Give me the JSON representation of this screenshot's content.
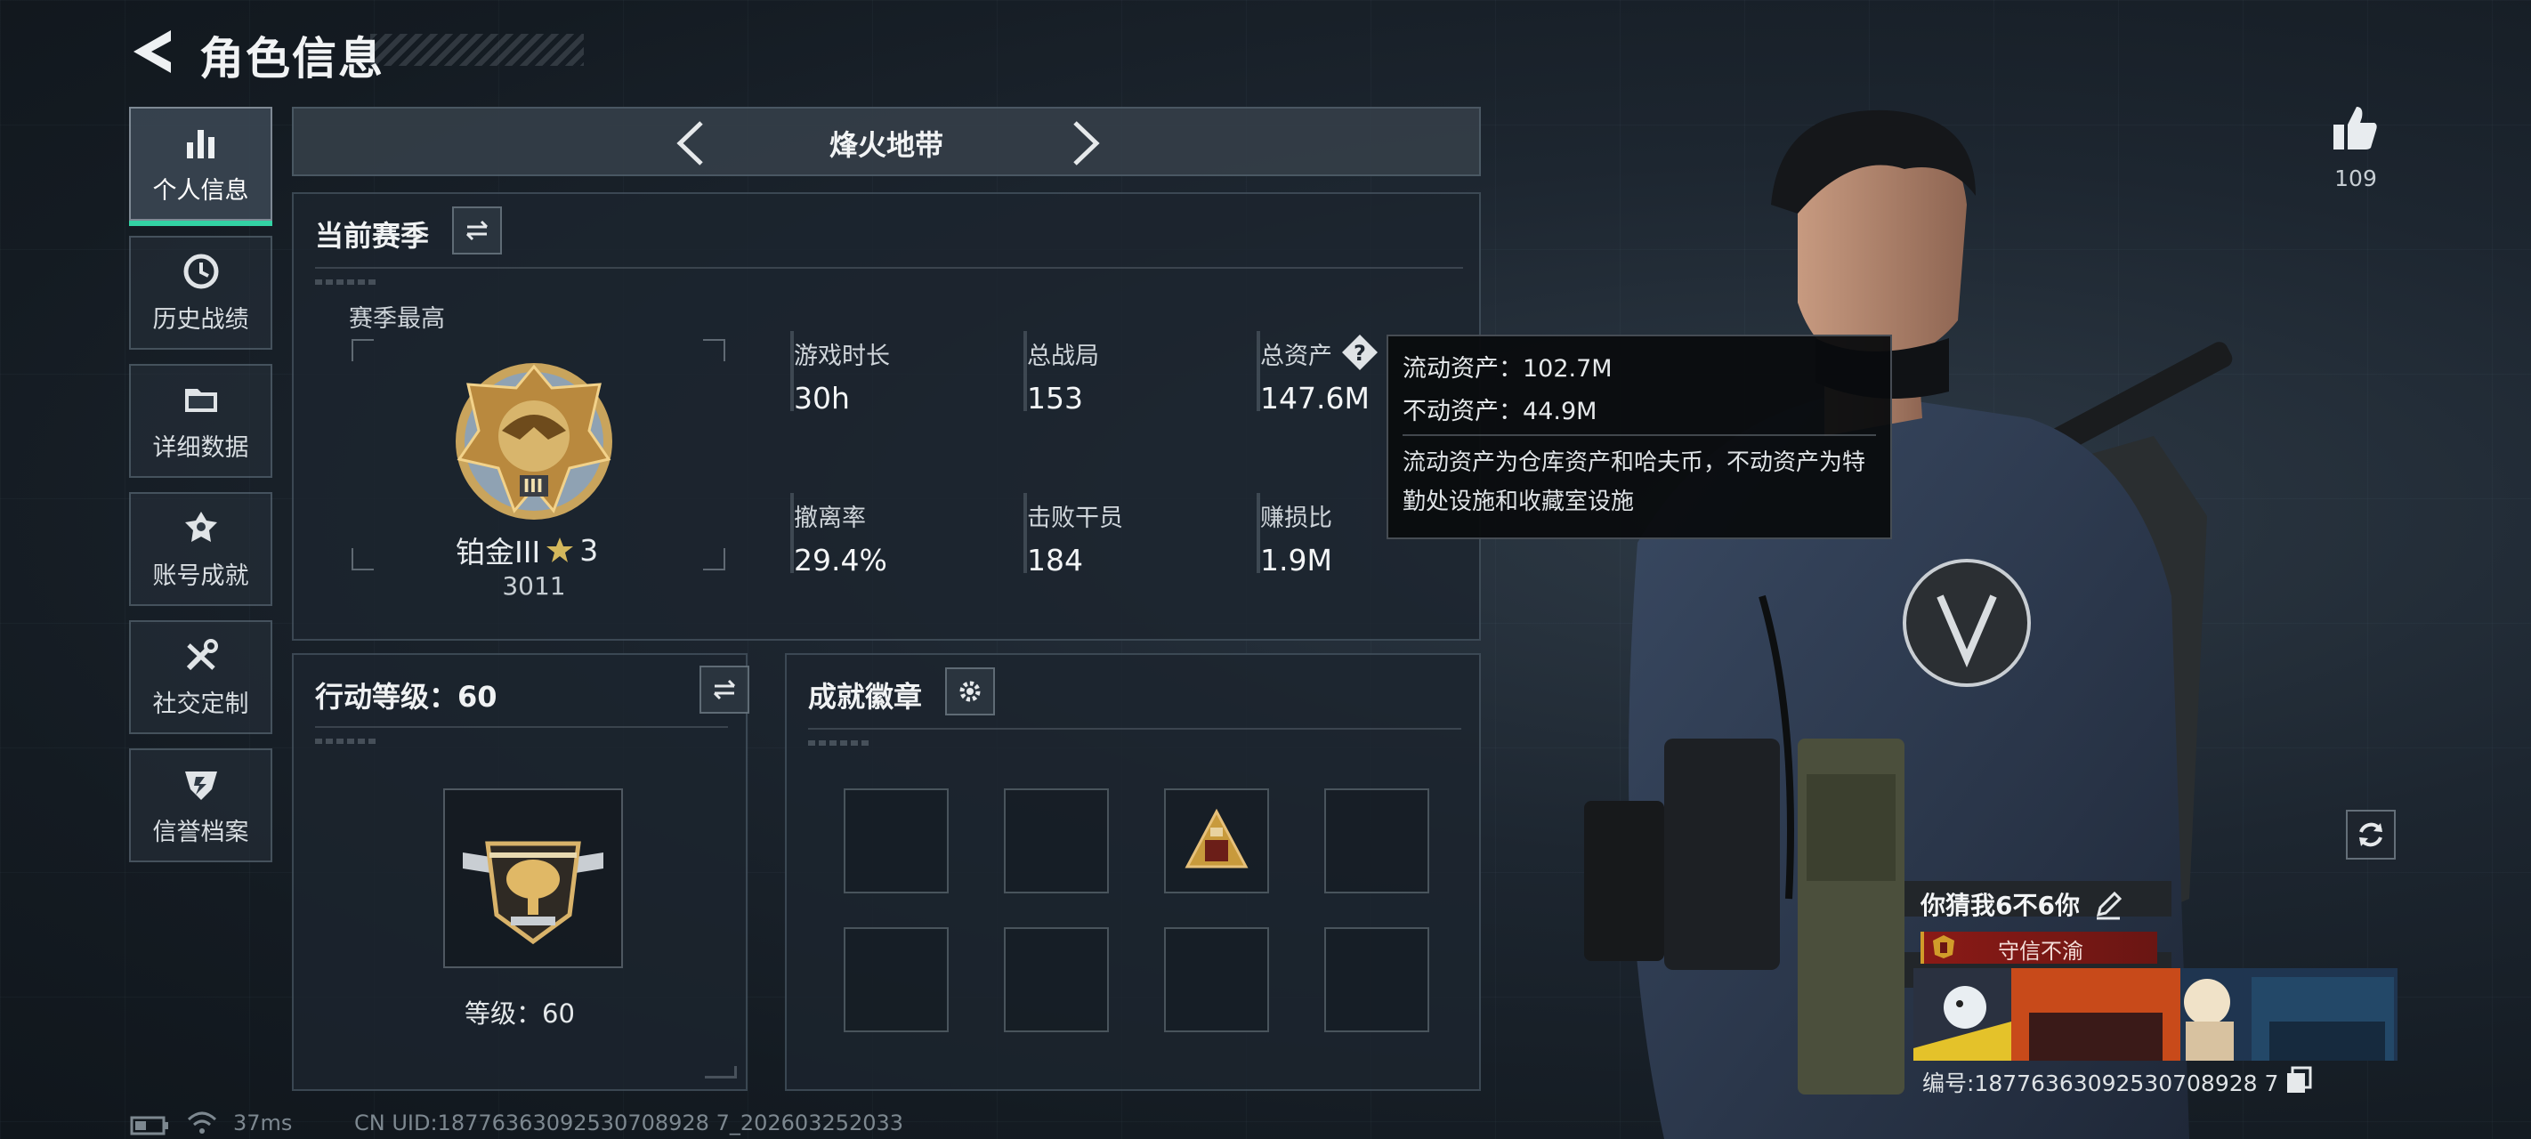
{
  "header": {
    "title": "角色信息"
  },
  "sidebar": {
    "items": [
      {
        "label": "个人信息",
        "icon": "bar-chart-icon",
        "active": true
      },
      {
        "label": "历史战绩",
        "icon": "clock-icon"
      },
      {
        "label": "详细数据",
        "icon": "folder-icon"
      },
      {
        "label": "账号成就",
        "icon": "trophy-icon"
      },
      {
        "label": "社交定制",
        "icon": "tools-icon"
      },
      {
        "label": "信誉档案",
        "icon": "shield-icon"
      }
    ]
  },
  "mode": {
    "title": "烽火地带"
  },
  "season": {
    "title": "当前赛季",
    "best_label": "赛季最高",
    "rank_name": "铂金III",
    "rank_stars": "3",
    "rank_score": "3011",
    "rank_roman": "III",
    "stats": [
      {
        "label": "游戏时长",
        "value": "30h"
      },
      {
        "label": "总战局",
        "value": "153"
      },
      {
        "label": "总资产",
        "value": "147.6M"
      },
      {
        "label": "撤离率",
        "value": "29.4%"
      },
      {
        "label": "击败干员",
        "value": "184"
      },
      {
        "label": "赚损比",
        "value": "1.9M"
      }
    ]
  },
  "tooltip": {
    "liquid": "流动资产：102.7M",
    "fixed": "不动资产：44.9M",
    "description": "流动资产为仓库资产和哈夫币，不动资产为特勤处设施和收藏室设施"
  },
  "action_level": {
    "title": "行动等级：60",
    "level_text": "等级：60"
  },
  "achievements": {
    "title": "成就徽章"
  },
  "likes": {
    "count": "109"
  },
  "profile": {
    "nickname": "你猜我6不6你",
    "honor": "守信不渝",
    "uid_line": "编号:18776363092530708928 7"
  },
  "status": {
    "ping": "37ms",
    "uid_footer": "CN UID:18776363092530708928 7_202603252033"
  },
  "colors": {
    "accent": "#33d2a4",
    "honor_red": "#8a1a16",
    "gold": "#d4a94a"
  }
}
